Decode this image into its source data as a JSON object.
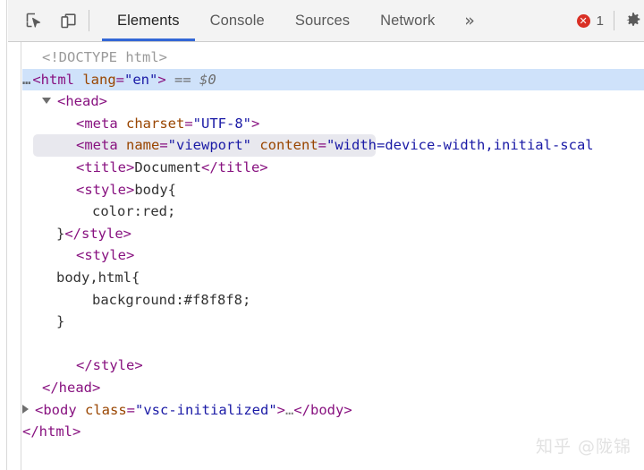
{
  "toolbar": {
    "inspect_icon": "inspect-element-cursor-icon",
    "device_icon": "device-toolbar-icon",
    "tabs": [
      {
        "label": "Elements",
        "active": true
      },
      {
        "label": "Console",
        "active": false
      },
      {
        "label": "Sources",
        "active": false
      },
      {
        "label": "Network",
        "active": false
      }
    ],
    "overflow_label": "»",
    "error_glyph": "✕",
    "error_count": "1",
    "settings_icon": "gear-icon",
    "active_underline_color": "#3367d6",
    "error_color": "#d93025"
  },
  "dom_tree": {
    "rows": [
      {
        "id": "doctype",
        "indent": 1,
        "state": "normal",
        "parts": [
          {
            "cls": "doctype",
            "t": "<!DOCTYPE html>"
          }
        ]
      },
      {
        "id": "html-open",
        "indent": 0,
        "state": "selected",
        "prefix": "…",
        "parts": [
          {
            "cls": "tag",
            "t": "<html "
          },
          {
            "cls": "attr",
            "t": "lang"
          },
          {
            "cls": "punct",
            "t": "="
          },
          {
            "cls": "val",
            "t": "\"en\""
          },
          {
            "cls": "tag",
            "t": ">"
          },
          {
            "cls": "eq0",
            "t": " == "
          },
          {
            "cls": "dollar",
            "t": "$0"
          }
        ]
      },
      {
        "id": "head-open",
        "indent": 1,
        "state": "normal",
        "twisty": "open",
        "parts": [
          {
            "cls": "tag",
            "t": "<head>"
          }
        ]
      },
      {
        "id": "meta-charset",
        "indent": 3,
        "state": "normal",
        "parts": [
          {
            "cls": "tag",
            "t": "<meta "
          },
          {
            "cls": "attr",
            "t": "charset"
          },
          {
            "cls": "punct",
            "t": "="
          },
          {
            "cls": "val",
            "t": "\"UTF-8\""
          },
          {
            "cls": "tag",
            "t": ">"
          }
        ]
      },
      {
        "id": "meta-viewport",
        "indent": 3,
        "state": "hovered",
        "parts": [
          {
            "cls": "tag",
            "t": "<meta "
          },
          {
            "cls": "attr",
            "t": "name"
          },
          {
            "cls": "punct",
            "t": "="
          },
          {
            "cls": "val",
            "t": "\"viewport\""
          },
          {
            "cls": "tag",
            "t": " "
          },
          {
            "cls": "attr",
            "t": "content"
          },
          {
            "cls": "punct",
            "t": "="
          },
          {
            "cls": "val",
            "t": "\"width=device-width,initial-scal"
          }
        ]
      },
      {
        "id": "title",
        "indent": 3,
        "state": "normal",
        "parts": [
          {
            "cls": "tag",
            "t": "<title>"
          },
          {
            "cls": "text",
            "t": "Document"
          },
          {
            "cls": "tag",
            "t": "</title>"
          }
        ]
      },
      {
        "id": "style1-open",
        "indent": 3,
        "state": "normal",
        "parts": [
          {
            "cls": "tag",
            "t": "<style>"
          },
          {
            "cls": "css",
            "t": "body{"
          }
        ]
      },
      {
        "id": "style1-rule",
        "indent": 4,
        "state": "normal",
        "parts": [
          {
            "cls": "css",
            "t": "color:red;"
          }
        ]
      },
      {
        "id": "style1-close",
        "indent": 2,
        "state": "normal",
        "parts": [
          {
            "cls": "css",
            "t": "}"
          },
          {
            "cls": "tag",
            "t": "</style>"
          }
        ]
      },
      {
        "id": "style2-open",
        "indent": 3,
        "state": "normal",
        "parts": [
          {
            "cls": "tag",
            "t": "<style>"
          }
        ]
      },
      {
        "id": "style2-sel",
        "indent": 2,
        "state": "normal",
        "parts": [
          {
            "cls": "css",
            "t": "body,html{"
          }
        ]
      },
      {
        "id": "style2-rule",
        "indent": 4,
        "state": "normal",
        "parts": [
          {
            "cls": "css",
            "t": "background:#f8f8f8;"
          }
        ]
      },
      {
        "id": "style2-brace",
        "indent": 2,
        "state": "normal",
        "parts": [
          {
            "cls": "css",
            "t": "}"
          }
        ]
      },
      {
        "id": "style2-blank",
        "indent": 2,
        "state": "normal",
        "parts": [
          {
            "cls": "css",
            "t": ""
          }
        ]
      },
      {
        "id": "style2-close",
        "indent": 3,
        "state": "normal",
        "parts": [
          {
            "cls": "tag",
            "t": "</style>"
          }
        ]
      },
      {
        "id": "head-close",
        "indent": 1,
        "state": "normal",
        "parts": [
          {
            "cls": "tag",
            "t": "</head>"
          }
        ]
      },
      {
        "id": "body-row",
        "indent": 0,
        "state": "normal",
        "twisty": "closed",
        "parts": [
          {
            "cls": "tag",
            "t": "<body "
          },
          {
            "cls": "attr",
            "t": "class"
          },
          {
            "cls": "punct",
            "t": "="
          },
          {
            "cls": "val",
            "t": "\"vsc-initialized\""
          },
          {
            "cls": "tag",
            "t": ">"
          },
          {
            "cls": "dots",
            "t": "…"
          },
          {
            "cls": "tag",
            "t": "</body>"
          }
        ]
      },
      {
        "id": "html-close",
        "indent": 0,
        "state": "normal",
        "parts": [
          {
            "cls": "tag",
            "t": "</html>"
          }
        ]
      }
    ]
  },
  "watermark": {
    "text": "知乎 @陇锦"
  }
}
